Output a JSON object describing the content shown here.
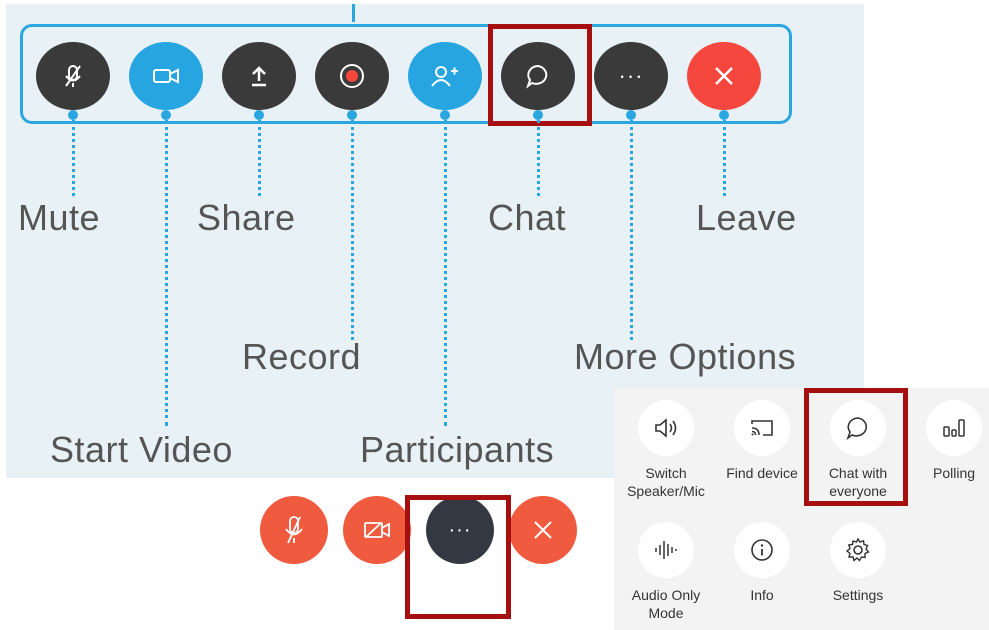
{
  "diagram": {
    "labels": {
      "mute": "Mute",
      "share": "Share",
      "chat": "Chat",
      "leave": "Leave",
      "record": "Record",
      "more_options": "More Options",
      "start_video": "Start Video",
      "participants": "Participants"
    },
    "more_glyph": "···",
    "highlighted": "chat"
  },
  "mobile_bar": {
    "more_glyph": "···",
    "highlighted": "more"
  },
  "options_menu": {
    "items": [
      {
        "label": "Switch Speaker/Mic",
        "icon": "speaker-icon"
      },
      {
        "label": "Find device",
        "icon": "cast-icon"
      },
      {
        "label": "Chat with everyone",
        "icon": "chat-bubble-icon"
      },
      {
        "label": "Polling",
        "icon": "polling-icon"
      },
      {
        "label": "Audio Only Mode",
        "icon": "audio-wave-icon"
      },
      {
        "label": "Info",
        "icon": "info-icon"
      },
      {
        "label": "Settings",
        "icon": "settings-gear-icon"
      }
    ],
    "highlighted": "Chat with everyone"
  },
  "colors": {
    "accent_blue": "#27a5e1",
    "dark_button": "#3a3a3a",
    "leave_red": "#f5473d",
    "mobile_orange": "#f05a3e",
    "highlight_box": "#a50f0f",
    "diagram_bg": "#e8f1f5"
  }
}
